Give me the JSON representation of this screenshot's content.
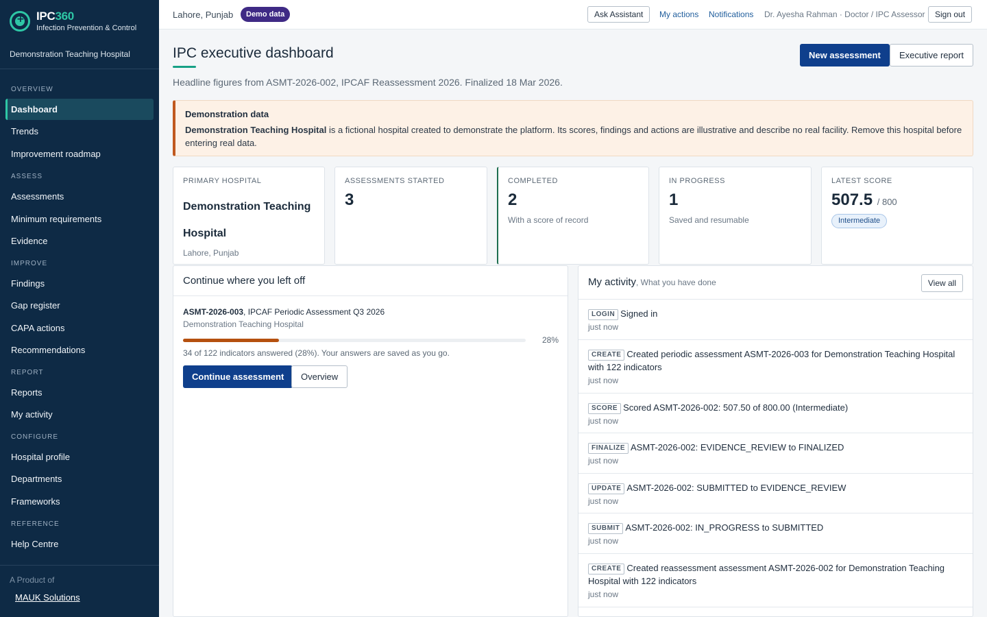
{
  "sidebar": {
    "brand_name_a": "IPC",
    "brand_name_b": "360",
    "brand_sub": "Infection Prevention & Control",
    "hospital": "Demonstration Teaching Hospital",
    "sections": {
      "overview": "OVERVIEW",
      "assess": "ASSESS",
      "improve": "IMPROVE",
      "report": "REPORT",
      "configure": "CONFIGURE",
      "reference": "REFERENCE"
    },
    "items": {
      "dashboard": "Dashboard",
      "trends": "Trends",
      "roadmap": "Improvement roadmap",
      "assessments": "Assessments",
      "minreq": "Minimum requirements",
      "evidence": "Evidence",
      "findings": "Findings",
      "gap": "Gap register",
      "capa": "CAPA actions",
      "recommendations": "Recommendations",
      "reports": "Reports",
      "myactivity": "My activity",
      "profile": "Hospital profile",
      "departments": "Departments",
      "frameworks": "Frameworks",
      "help": "Help Centre"
    },
    "footer_label": "A Product of",
    "footer_link": "MAUK Solutions"
  },
  "topbar": {
    "location": "Lahore, Punjab",
    "demo_badge": "Demo data",
    "ask": "Ask Assistant",
    "my_actions": "My actions",
    "notifications": "Notifications",
    "user": "Dr. Ayesha Rahman · Doctor / IPC Assessor",
    "sign_out": "Sign out"
  },
  "header": {
    "title": "IPC executive dashboard",
    "subtitle": "Headline figures from ASMT-2026-002, IPCAF Reassessment 2026. Finalized 18 Mar 2026.",
    "new_assessment": "New assessment",
    "executive_report": "Executive report"
  },
  "banner": {
    "title": "Demonstration data",
    "hospital": "Demonstration Teaching Hospital",
    "body": " is a fictional hospital created to demonstrate the platform. Its scores, findings and actions are illustrative and describe no real facility. Remove this hospital before entering real data."
  },
  "cards": {
    "primary": {
      "label": "PRIMARY HOSPITAL",
      "value": "Demonstration Teaching Hospital",
      "sub": "Lahore, Punjab"
    },
    "started": {
      "label": "ASSESSMENTS STARTED",
      "value": "3"
    },
    "completed": {
      "label": "COMPLETED",
      "value": "2",
      "sub": "With a score of record"
    },
    "progress": {
      "label": "IN PROGRESS",
      "value": "1",
      "sub": "Saved and resumable"
    },
    "score": {
      "label": "LATEST SCORE",
      "value": "507.5",
      "of": "/ 800",
      "badge": "Intermediate"
    }
  },
  "continue": {
    "title": "Continue where you left off",
    "code": "ASMT-2026-003",
    "name": ", IPCAF Periodic Assessment Q3 2026",
    "hospital": "Demonstration Teaching Hospital",
    "progress_fraction": 0.28,
    "percent": "28%",
    "note": "34 of 122 indicators answered (28%). Your answers are saved as you go.",
    "continue_button": "Continue assessment",
    "overview_button": "Overview"
  },
  "activity": {
    "title": "My activity",
    "subtitle": ", What you have done",
    "view_all": "View all",
    "items": [
      {
        "tag": "LOGIN",
        "text": "Signed in",
        "time": "just now"
      },
      {
        "tag": "CREATE",
        "text": "Created periodic assessment ASMT-2026-003 for Demonstration Teaching Hospital with 122 indicators",
        "time": "just now"
      },
      {
        "tag": "SCORE",
        "text": "Scored ASMT-2026-002: 507.50 of 800.00 (Intermediate)",
        "time": "just now"
      },
      {
        "tag": "FINALIZE",
        "text": "ASMT-2026-002: EVIDENCE_REVIEW to FINALIZED",
        "time": "just now"
      },
      {
        "tag": "UPDATE",
        "text": "ASMT-2026-002: SUBMITTED to EVIDENCE_REVIEW",
        "time": "just now"
      },
      {
        "tag": "SUBMIT",
        "text": "ASMT-2026-002: IN_PROGRESS to SUBMITTED",
        "time": "just now"
      },
      {
        "tag": "CREATE",
        "text": "Created reassessment assessment ASMT-2026-002 for Demonstration Teaching Hospital with 122 indicators",
        "time": "just now"
      }
    ]
  }
}
